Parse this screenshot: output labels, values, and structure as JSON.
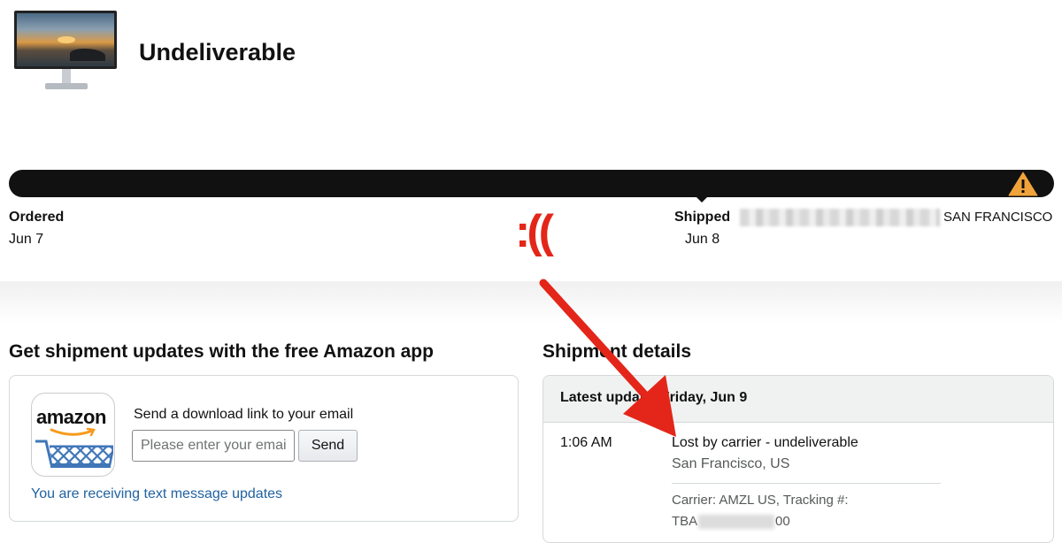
{
  "product": {
    "image_icon": "monitor-icon"
  },
  "status_title": "Undeliverable",
  "progress": {
    "fill_fraction": 1.0,
    "warning_icon": "warning-icon",
    "ordered_label": "Ordered",
    "ordered_date": "Jun 7",
    "shipped_label": "Shipped",
    "shipped_city": "SAN FRANCISCO",
    "shipped_date": "Jun 8"
  },
  "annotation": {
    "sad_face": ":((",
    "arrow_color": "#e32619"
  },
  "app_promo": {
    "heading": "Get shipment updates with the free Amazon app",
    "logo_text": "amazon",
    "send_label": "Send a download link to your email",
    "email_placeholder": "Please enter your email",
    "send_button": "Send",
    "sms_link": "You are receiving text message updates"
  },
  "shipment": {
    "heading": "Shipment details",
    "latest_update": "Latest update: Friday, Jun 9",
    "events": [
      {
        "time": "1:06 AM",
        "status": "Lost by carrier - undeliverable",
        "location": "San Francisco, US"
      }
    ],
    "carrier": "Carrier: AMZL US, Tracking #:",
    "tracking_prefix": "TBA",
    "tracking_suffix": "00"
  },
  "colors": {
    "link": "#2162a1",
    "warning": "#f0a33a",
    "bar": "#111111"
  }
}
